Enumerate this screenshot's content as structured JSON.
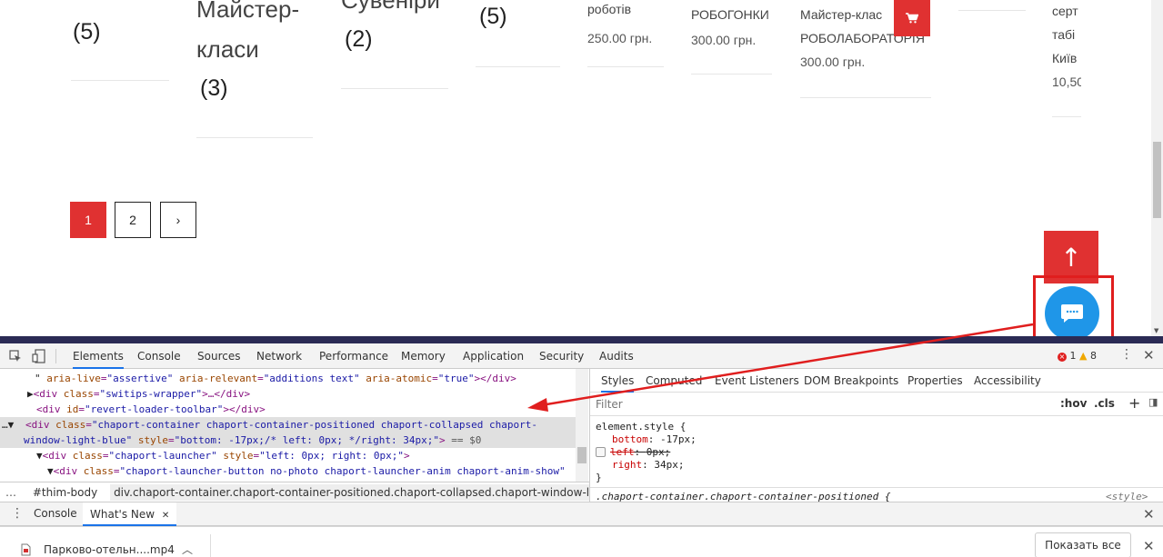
{
  "categories": [
    {
      "name_lines": [],
      "count": "(5)"
    },
    {
      "name_lines": [
        "Майстер-",
        "класи"
      ],
      "count": "(3)"
    },
    {
      "name_lines": [
        "Сувеніри"
      ],
      "count": "(2)"
    },
    {
      "name_lines": [],
      "count": "(5)"
    }
  ],
  "products": [
    {
      "title": "роботів",
      "price": "250.00 грн."
    },
    {
      "title": "РОБОГОНКИ",
      "price": "300.00 грн."
    },
    {
      "title": "Майстер-клас",
      "title2": "РОБОЛАБОРАТОРІЯ",
      "price": "300.00 грн."
    },
    {
      "title": "серт",
      "title2": "табі",
      "title3": "Київ",
      "price": "10,50"
    }
  ],
  "pagination": {
    "pages": [
      "1",
      "2"
    ],
    "next": "›",
    "current": "1"
  },
  "floating": {
    "to_top": "↑",
    "chat_dots": "····"
  },
  "devtools": {
    "tabs": [
      "Elements",
      "Console",
      "Sources",
      "Network",
      "Performance",
      "Memory",
      "Application",
      "Security",
      "Audits"
    ],
    "active_tab": "Elements",
    "errors": "1",
    "warnings": "8",
    "code": {
      "l1_attr1": "aria-live",
      "l1_val1": "\"assertive\"",
      "l1_attr2": "aria-relevant",
      "l1_val2": "\"additions text\"",
      "l1_attr3": "aria-atomic",
      "l1_val3": "\"true\"",
      "l1_close": "></div>",
      "l2_attr": "class",
      "l2_val": "\"switips-wrapper\"",
      "l2_mid": ">…</div>",
      "l3_attr": "id",
      "l3_val": "\"revert-loader-toolbar\"",
      "l3_close": "></div>",
      "l4_attr": "class",
      "l4_val": "\"chaport-container chaport-container-positioned chaport-collapsed chaport-",
      "l5_val": "window-light-blue\"",
      "l5_attr": "style",
      "l5_style": "\"bottom: -17px;/* left: 0px; */right: 34px;\"",
      "l5_eq": "== $0",
      "l6_attr1": "class",
      "l6_val1": "\"chaport-launcher\"",
      "l6_attr2": "style",
      "l6_val2": "\"left: 0px; right: 0px;\"",
      "l7_attr": "class",
      "l7_val": "\"chaport-launcher-button no-photo chaport-launcher-anim chaport-anim-show\""
    },
    "breadcrumb": [
      "#thim-body",
      "div.chaport-container.chaport-container-positioned.chaport-collapsed.chaport-window-light-blue"
    ],
    "styles_tabs": [
      "Styles",
      "Computed",
      "Event Listeners",
      "DOM Breakpoints",
      "Properties",
      "Accessibility"
    ],
    "filter_placeholder": "Filter",
    "hov": ":hov",
    "cls": ".cls",
    "element_style": "element.style {",
    "rule1_prop": "bottom",
    "rule1_val": "-17px;",
    "rule2_prop": "left",
    "rule2_val": "0px;",
    "rule3_prop": "right",
    "rule3_val": "34px;",
    "close_brace": "}",
    "next_rule": ".chaport-container.chaport-container-positioned {",
    "next_rule_src": "<style>",
    "drawer_tabs": [
      "Console",
      "What's New"
    ]
  },
  "downloads": {
    "file_name": "Парково-отельн....mp4",
    "show_all": "Показать все"
  },
  "colors": {
    "accent_red": "#e03131",
    "chat_blue": "#1f96e8",
    "navy": "#2b2b55",
    "devtools_blue": "#1a73e8"
  }
}
